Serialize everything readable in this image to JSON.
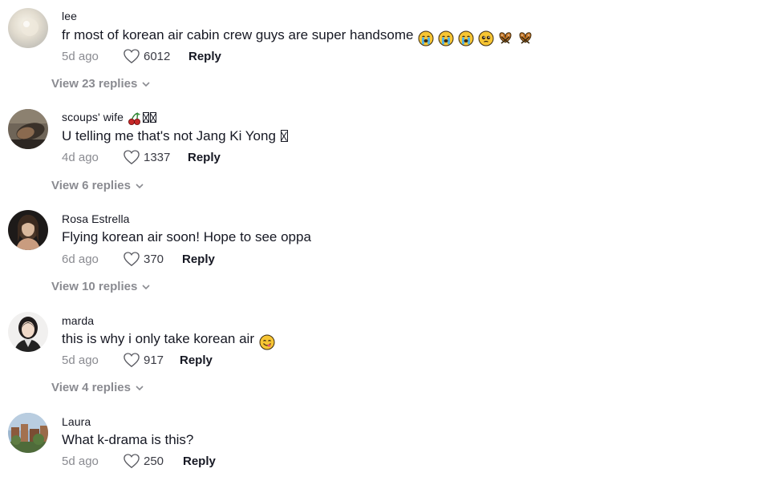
{
  "labels": {
    "reply": "Reply"
  },
  "comments": [
    {
      "username": "lee",
      "text": "fr most of korean air cabin crew guys are super handsome",
      "emoji_icons": [
        "loudly-crying-face-icon",
        "loudly-crying-face-icon",
        "loudly-crying-face-icon",
        "pleading-face-icon",
        "pretzel-icon",
        "pretzel-icon"
      ],
      "time": "5d ago",
      "likes": "6012",
      "view_replies": "View 23 replies"
    },
    {
      "username": "scoups' wife",
      "username_icons": [
        "cherries-icon",
        "missing-glyph-icon",
        "missing-glyph-icon"
      ],
      "text": "U telling me that's not Jang Ki Yong",
      "text_icons": [
        "missing-glyph-icon"
      ],
      "time": "4d ago",
      "likes": "1337",
      "view_replies": "View 6 replies"
    },
    {
      "username": "Rosa Estrella",
      "text": "Flying korean air soon! Hope to see oppa",
      "time": "6d ago",
      "likes": "370",
      "view_replies": "View 10 replies"
    },
    {
      "username": "marda",
      "text": "this is why i only take korean air",
      "emoji_icons": [
        "face-savoring-food-icon"
      ],
      "time": "5d ago",
      "likes": "917",
      "view_replies": "View 4 replies"
    },
    {
      "username": "Laura",
      "text": "What k-drama is this?",
      "time": "5d ago",
      "likes": "250"
    }
  ],
  "colors": {
    "text": "#161823",
    "muted": "#8a8b91",
    "background": "#ffffff"
  }
}
